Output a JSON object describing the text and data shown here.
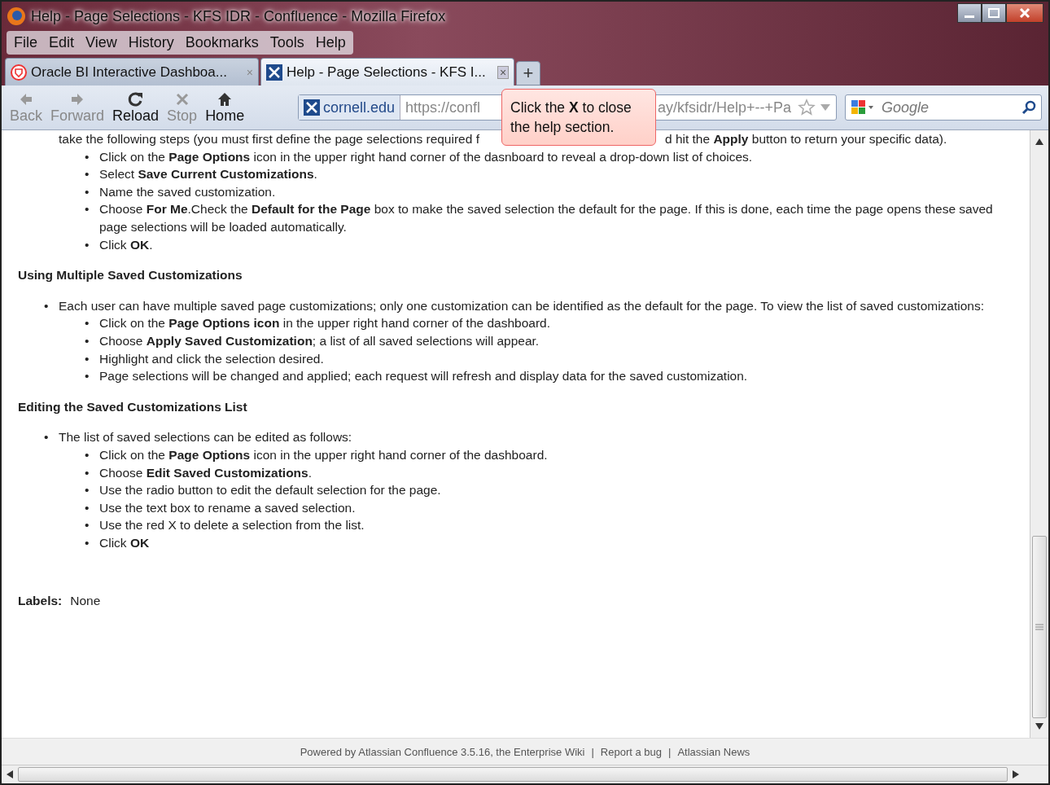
{
  "window": {
    "title": "Help - Page Selections - KFS IDR - Confluence - Mozilla Firefox"
  },
  "menu": [
    {
      "label": "File"
    },
    {
      "label": "Edit"
    },
    {
      "label": "View"
    },
    {
      "label": "History"
    },
    {
      "label": "Bookmarks"
    },
    {
      "label": "Tools"
    },
    {
      "label": "Help"
    }
  ],
  "tabs": [
    {
      "label": "Oracle BI Interactive Dashboa...",
      "kind": "oracle",
      "selected": false,
      "close": "×"
    },
    {
      "label": "Help - Page Selections - KFS I...",
      "kind": "confluence",
      "selected": true,
      "close": "×"
    }
  ],
  "bullet": "•",
  "new_tab": "+",
  "nav": [
    {
      "label": "Back",
      "kind": "back",
      "disabled": true
    },
    {
      "label": "Forward",
      "kind": "forward",
      "disabled": true
    },
    {
      "label": "Reload",
      "kind": "reload",
      "disabled": false
    },
    {
      "label": "Stop",
      "kind": "stop",
      "disabled": true
    },
    {
      "label": "Home",
      "kind": "home",
      "disabled": false
    }
  ],
  "address": {
    "site": "cornell.edu",
    "url_start": "https://confl",
    "url_end": "ay/kfsidr/Help+--+Pa"
  },
  "search": {
    "placeholder": "Google"
  },
  "tooltip": "Click the **X** to close the help section.",
  "content": [
    {
      "kind": "cut",
      "left": "take the following steps (you must first define the page selections required f",
      "right": "d hit the **Apply** button to return your specific data)."
    },
    {
      "kind": "sublist",
      "items": [
        {
          "text": "Click on the **Page Options** icon  in the upper right hand corner of the dasnboard to reveal a drop-down list of choices."
        },
        {
          "text": "Select **Save Current Customizations**."
        },
        {
          "text": "Name the saved customization."
        },
        {
          "text": "Choose **For Me**.Check the **Default for the Page** box to make the saved selection the default for the page. If this is done, each time the page opens these saved page selections will be loaded automatically."
        },
        {
          "text": "Click **OK**."
        }
      ]
    },
    {
      "kind": "heading",
      "text": "Using Multiple Saved Customizations"
    },
    {
      "kind": "list",
      "items": [
        {
          "text": "Each user can have multiple saved page customizations; only one customization can be identified as the default for the page. To view the list of saved customizations:",
          "children": [
            {
              "text": "Click on the **Page Options icon**  in the upper right hand corner of the dashboard."
            },
            {
              "text": "Choose **Apply Saved Customization**; a list of all saved selections will appear."
            },
            {
              "text": "Highlight and click the selection desired."
            },
            {
              "text": "Page selections will be changed and applied; each request will refresh and display data for the saved customization."
            }
          ]
        }
      ]
    },
    {
      "kind": "heading",
      "text": "Editing the Saved Customizations List"
    },
    {
      "kind": "list",
      "items": [
        {
          "text": "The list of saved selections can be edited as follows:",
          "children": [
            {
              "text": "Click on the **Page Options** icon in the upper right hand corner of the dashboard."
            },
            {
              "text": "Choose **Edit Saved Customizations**."
            },
            {
              "text": "Use the radio button to edit the default selection for the page."
            },
            {
              "text": "Use the text box to rename a saved selection."
            },
            {
              "text": "Use the red X to delete a selection from the list."
            },
            {
              "text": "Click **OK**"
            }
          ]
        }
      ]
    },
    {
      "kind": "labels",
      "label": "Labels:",
      "value": "None"
    }
  ],
  "footer": {
    "powered": "Powered by Atlassian Confluence 3.5.16, the Enterprise Wiki",
    "links": [
      "Report a bug",
      "Atlassian News"
    ],
    "separator": "|"
  }
}
